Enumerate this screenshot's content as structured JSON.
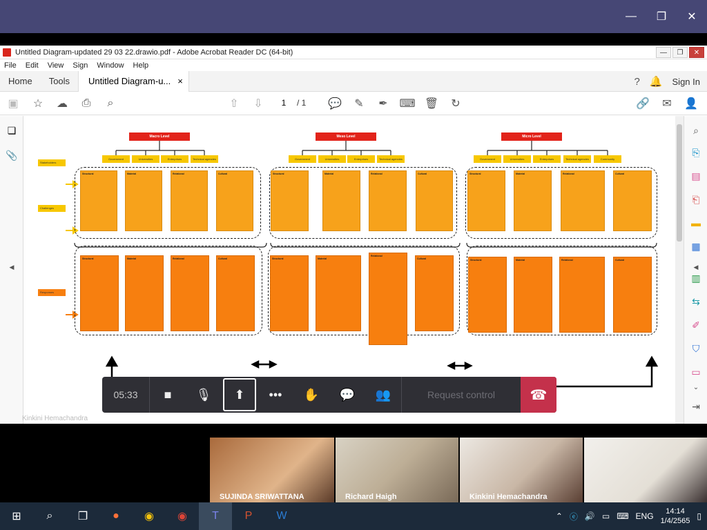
{
  "teams": {
    "minimize": "—",
    "restore": "❐",
    "close": "✕"
  },
  "acrobat": {
    "title": "Untitled Diagram-updated 29 03 22.drawio.pdf - Adobe Acrobat Reader DC (64-bit)",
    "menu": [
      "File",
      "Edit",
      "View",
      "Sign",
      "Window",
      "Help"
    ],
    "tabs": {
      "home": "Home",
      "tools": "Tools",
      "doc": "Untitled Diagram-u...",
      "close": "×"
    },
    "sign_in": "Sign In",
    "page_current": "1",
    "page_total": "/ 1"
  },
  "diagram": {
    "levels": [
      "Macro Level",
      "Meso Level",
      "Micro Level"
    ],
    "stakeholders_label": "Stakeholders",
    "challenges_label": "Challenges",
    "responses_label": "Responses",
    "group1": [
      "Government",
      "Universities",
      "Enterprises",
      "Technical agencies"
    ],
    "group2": [
      "Government",
      "Universities",
      "Enterprises",
      "Technical agencies"
    ],
    "group3": [
      "Government",
      "Universities",
      "Enterprises",
      "Technical agencies",
      "Community"
    ],
    "card_titles": [
      "Structural",
      "Material",
      "Relational",
      "Cultural"
    ]
  },
  "speaker_caption": "Kinkini Hemachandra",
  "call": {
    "timer": "05:33",
    "request_control": "Request control"
  },
  "participants": [
    {
      "name": "SUJINDA SRIWATTANA"
    },
    {
      "name": "Richard Haigh"
    },
    {
      "name": "Kinkini Hemachandra"
    },
    {
      "name": ""
    }
  ],
  "taskbar": {
    "language": "ENG",
    "time": "14:14",
    "date": "1/4/2565"
  }
}
